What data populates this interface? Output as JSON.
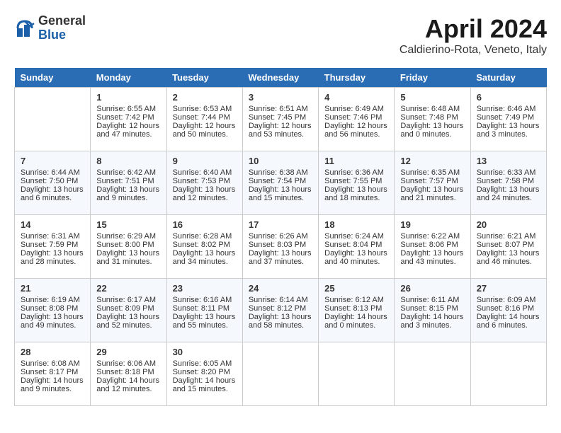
{
  "header": {
    "logo_general": "General",
    "logo_blue": "Blue",
    "month_title": "April 2024",
    "location": "Caldierino-Rota, Veneto, Italy"
  },
  "calendar": {
    "days_of_week": [
      "Sunday",
      "Monday",
      "Tuesday",
      "Wednesday",
      "Thursday",
      "Friday",
      "Saturday"
    ],
    "weeks": [
      [
        {
          "day": "",
          "content": ""
        },
        {
          "day": "1",
          "content": "Sunrise: 6:55 AM\nSunset: 7:42 PM\nDaylight: 12 hours\nand 47 minutes."
        },
        {
          "day": "2",
          "content": "Sunrise: 6:53 AM\nSunset: 7:44 PM\nDaylight: 12 hours\nand 50 minutes."
        },
        {
          "day": "3",
          "content": "Sunrise: 6:51 AM\nSunset: 7:45 PM\nDaylight: 12 hours\nand 53 minutes."
        },
        {
          "day": "4",
          "content": "Sunrise: 6:49 AM\nSunset: 7:46 PM\nDaylight: 12 hours\nand 56 minutes."
        },
        {
          "day": "5",
          "content": "Sunrise: 6:48 AM\nSunset: 7:48 PM\nDaylight: 13 hours\nand 0 minutes."
        },
        {
          "day": "6",
          "content": "Sunrise: 6:46 AM\nSunset: 7:49 PM\nDaylight: 13 hours\nand 3 minutes."
        }
      ],
      [
        {
          "day": "7",
          "content": "Sunrise: 6:44 AM\nSunset: 7:50 PM\nDaylight: 13 hours\nand 6 minutes."
        },
        {
          "day": "8",
          "content": "Sunrise: 6:42 AM\nSunset: 7:51 PM\nDaylight: 13 hours\nand 9 minutes."
        },
        {
          "day": "9",
          "content": "Sunrise: 6:40 AM\nSunset: 7:53 PM\nDaylight: 13 hours\nand 12 minutes."
        },
        {
          "day": "10",
          "content": "Sunrise: 6:38 AM\nSunset: 7:54 PM\nDaylight: 13 hours\nand 15 minutes."
        },
        {
          "day": "11",
          "content": "Sunrise: 6:36 AM\nSunset: 7:55 PM\nDaylight: 13 hours\nand 18 minutes."
        },
        {
          "day": "12",
          "content": "Sunrise: 6:35 AM\nSunset: 7:57 PM\nDaylight: 13 hours\nand 21 minutes."
        },
        {
          "day": "13",
          "content": "Sunrise: 6:33 AM\nSunset: 7:58 PM\nDaylight: 13 hours\nand 24 minutes."
        }
      ],
      [
        {
          "day": "14",
          "content": "Sunrise: 6:31 AM\nSunset: 7:59 PM\nDaylight: 13 hours\nand 28 minutes."
        },
        {
          "day": "15",
          "content": "Sunrise: 6:29 AM\nSunset: 8:00 PM\nDaylight: 13 hours\nand 31 minutes."
        },
        {
          "day": "16",
          "content": "Sunrise: 6:28 AM\nSunset: 8:02 PM\nDaylight: 13 hours\nand 34 minutes."
        },
        {
          "day": "17",
          "content": "Sunrise: 6:26 AM\nSunset: 8:03 PM\nDaylight: 13 hours\nand 37 minutes."
        },
        {
          "day": "18",
          "content": "Sunrise: 6:24 AM\nSunset: 8:04 PM\nDaylight: 13 hours\nand 40 minutes."
        },
        {
          "day": "19",
          "content": "Sunrise: 6:22 AM\nSunset: 8:06 PM\nDaylight: 13 hours\nand 43 minutes."
        },
        {
          "day": "20",
          "content": "Sunrise: 6:21 AM\nSunset: 8:07 PM\nDaylight: 13 hours\nand 46 minutes."
        }
      ],
      [
        {
          "day": "21",
          "content": "Sunrise: 6:19 AM\nSunset: 8:08 PM\nDaylight: 13 hours\nand 49 minutes."
        },
        {
          "day": "22",
          "content": "Sunrise: 6:17 AM\nSunset: 8:09 PM\nDaylight: 13 hours\nand 52 minutes."
        },
        {
          "day": "23",
          "content": "Sunrise: 6:16 AM\nSunset: 8:11 PM\nDaylight: 13 hours\nand 55 minutes."
        },
        {
          "day": "24",
          "content": "Sunrise: 6:14 AM\nSunset: 8:12 PM\nDaylight: 13 hours\nand 58 minutes."
        },
        {
          "day": "25",
          "content": "Sunrise: 6:12 AM\nSunset: 8:13 PM\nDaylight: 14 hours\nand 0 minutes."
        },
        {
          "day": "26",
          "content": "Sunrise: 6:11 AM\nSunset: 8:15 PM\nDaylight: 14 hours\nand 3 minutes."
        },
        {
          "day": "27",
          "content": "Sunrise: 6:09 AM\nSunset: 8:16 PM\nDaylight: 14 hours\nand 6 minutes."
        }
      ],
      [
        {
          "day": "28",
          "content": "Sunrise: 6:08 AM\nSunset: 8:17 PM\nDaylight: 14 hours\nand 9 minutes."
        },
        {
          "day": "29",
          "content": "Sunrise: 6:06 AM\nSunset: 8:18 PM\nDaylight: 14 hours\nand 12 minutes."
        },
        {
          "day": "30",
          "content": "Sunrise: 6:05 AM\nSunset: 8:20 PM\nDaylight: 14 hours\nand 15 minutes."
        },
        {
          "day": "",
          "content": ""
        },
        {
          "day": "",
          "content": ""
        },
        {
          "day": "",
          "content": ""
        },
        {
          "day": "",
          "content": ""
        }
      ]
    ]
  }
}
